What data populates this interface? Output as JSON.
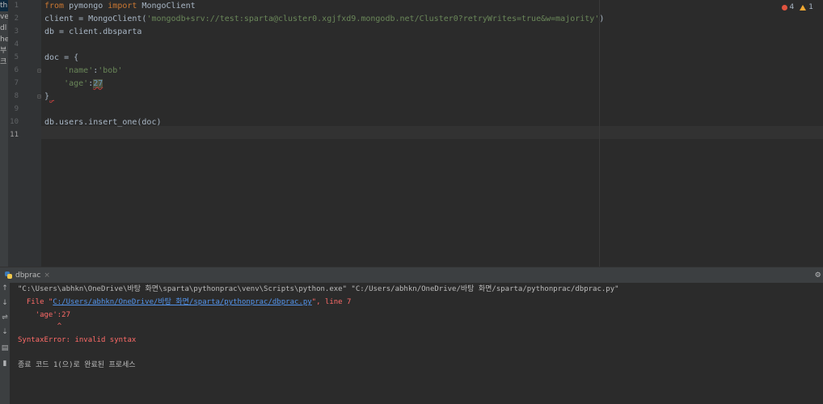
{
  "project_tree": {
    "items": [
      "th",
      "ve",
      "dl",
      "he",
      "부",
      "크"
    ]
  },
  "editor": {
    "line_numbers": [
      "1",
      "2",
      "3",
      "4",
      "5",
      "6",
      "7",
      "8",
      "9",
      "10",
      "11"
    ],
    "current_line": "11",
    "inspections": {
      "errors": "4",
      "warnings": "1"
    },
    "code": {
      "l1": {
        "from": "from",
        "module": " pymongo ",
        "import": "import",
        "name": " MongoClient"
      },
      "l2": {
        "prefix": "client = MongoClient(",
        "str": "'mongodb+srv://test:sparta@cluster0.xgjfxd9.mongodb.net/Cluster0?retryWrites=true&w=majority'",
        "suffix": ")"
      },
      "l3": "db = client.dbsparta",
      "l5": "doc = {",
      "l6": {
        "indent": "    ",
        "key": "'name'",
        "colon": ":",
        "val": "'bob'"
      },
      "l7": {
        "indent": "    ",
        "key": "'age'",
        "colon": ":",
        "val": "27"
      },
      "l8": {
        "brace": "}",
        "mark": "_"
      },
      "l10": "db.users.insert_one(doc)"
    }
  },
  "run": {
    "tab_label": "dbprac",
    "tab_close": "×",
    "settings_icon": "gear-icon",
    "side_icons": [
      "up-arrow-icon",
      "down-arrow-icon",
      "soft-wrap-icon",
      "scroll-to-end-icon",
      "print-icon",
      "trash-icon"
    ],
    "console": {
      "command": "\"C:\\Users\\abhkn\\OneDrive\\바탕 화면\\sparta\\pythonprac\\venv\\Scripts\\python.exe\" \"C:/Users/abhkn/OneDrive/바탕 화면/sparta/pythonprac/dbprac.py\"",
      "file_prefix": "  File \"",
      "file_link": "C:/Users/abhkn/OneDrive/바탕 화면/sparta/pythonprac/dbprac.py",
      "file_suffix": "\", line 7",
      "source_line": "    'age':27",
      "caret": "         ^",
      "error": "SyntaxError: invalid syntax",
      "exit": "종료 코드 1(으)로 완료된 프로세스"
    }
  }
}
